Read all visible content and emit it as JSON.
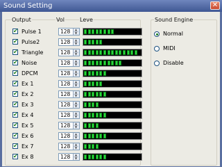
{
  "window": {
    "title": "Sound Setting",
    "close_glyph": "✕"
  },
  "mixer": {
    "header_output": "Output",
    "header_vol": "Vol",
    "header_level": "Leve",
    "meter_segment_count": 14,
    "channels": [
      {
        "name": "Pulse 1",
        "checked": true,
        "vol": "128",
        "level": 0.6
      },
      {
        "name": "Pulse2",
        "checked": true,
        "vol": "128",
        "level": 0.39
      },
      {
        "name": "Triangle",
        "checked": true,
        "vol": "128",
        "level": 1.0
      },
      {
        "name": "Noise",
        "checked": true,
        "vol": "128",
        "level": 0.7
      },
      {
        "name": "DPCM",
        "checked": true,
        "vol": "128",
        "level": 0.45
      },
      {
        "name": "Ex 1",
        "checked": true,
        "vol": "128",
        "level": 0.39
      },
      {
        "name": "Ex 2",
        "checked": true,
        "vol": "128",
        "level": 0.45
      },
      {
        "name": "Ex 3",
        "checked": true,
        "vol": "128",
        "level": 0.3
      },
      {
        "name": "Ex 4",
        "checked": true,
        "vol": "128",
        "level": 0.45
      },
      {
        "name": "Ex 5",
        "checked": true,
        "vol": "128",
        "level": 0.32
      },
      {
        "name": "Ex 6",
        "checked": true,
        "vol": "128",
        "level": 0.45
      },
      {
        "name": "Ex 7",
        "checked": true,
        "vol": "128",
        "level": 0.32
      },
      {
        "name": "Ex 8",
        "checked": true,
        "vol": "128",
        "level": 0.45
      }
    ]
  },
  "engine": {
    "title": "Sound Engine",
    "options": [
      {
        "label": "Normal",
        "selected": true
      },
      {
        "label": "MIDI",
        "selected": false
      },
      {
        "label": "Disable",
        "selected": false
      }
    ]
  },
  "colors": {
    "titlebar": "#3f5793",
    "meter_on": "#29d83a",
    "meter_bg": "#000000",
    "face": "#ecebe4"
  }
}
